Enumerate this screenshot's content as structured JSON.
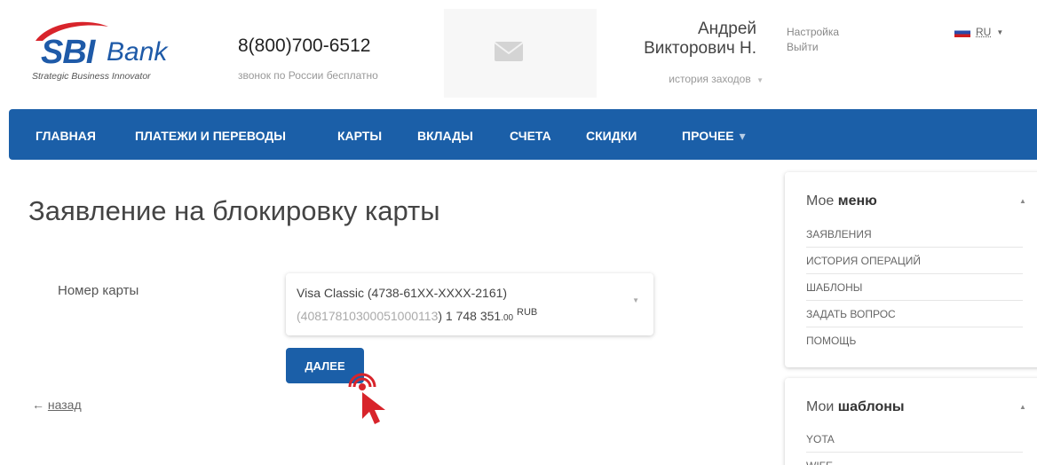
{
  "header": {
    "logo": {
      "brand": "SBI",
      "name": "Bank",
      "tagline": "Strategic Business Innovator"
    },
    "phone": "8(800)700-6512",
    "phone_note": "звонок по России бесплатно",
    "user": {
      "first_name": "Андрей",
      "last_name": "Викторович Н.",
      "history_label": "история заходов"
    },
    "settings_label": "Настройка",
    "logout_label": "Выйти",
    "language": "RU",
    "icons": {
      "mail": "mail-icon",
      "flag": "flag-ru-icon"
    }
  },
  "nav": {
    "items": [
      "ГЛАВНАЯ",
      "ПЛАТЕЖИ И ПЕРЕВОДЫ",
      "КАРТЫ",
      "ВКЛАДЫ",
      "СЧЕТА",
      "СКИДКИ",
      "ПРОЧЕЕ"
    ]
  },
  "main": {
    "title": "Заявление на блокировку карты",
    "card_field_label": "Номер карты",
    "card_select": {
      "card_name": "Visa Classic (4738-61XX-XXXX-2161)",
      "account_number": "40817810300051000113",
      "balance_int": "1 748 351",
      "balance_cents": ".00",
      "currency": "RUB"
    },
    "next_button": "ДАЛЕЕ",
    "back_arrow": "←",
    "back_label": "назад"
  },
  "sidebar": {
    "my_menu": {
      "title_prefix": "Мое",
      "title_bold": "меню",
      "items": [
        "ЗАЯВЛЕНИЯ",
        "ИСТОРИЯ ОПЕРАЦИЙ",
        "ШАБЛОНЫ",
        "ЗАДАТЬ ВОПРОС",
        "ПОМОЩЬ"
      ]
    },
    "my_templates": {
      "title_prefix": "Мои",
      "title_bold": "шаблоны",
      "items": [
        "YOTA",
        "WIFE"
      ]
    }
  },
  "colors": {
    "brand_blue": "#1b5fa8",
    "logo_red": "#d8242b",
    "cursor_red": "#d8242b"
  }
}
